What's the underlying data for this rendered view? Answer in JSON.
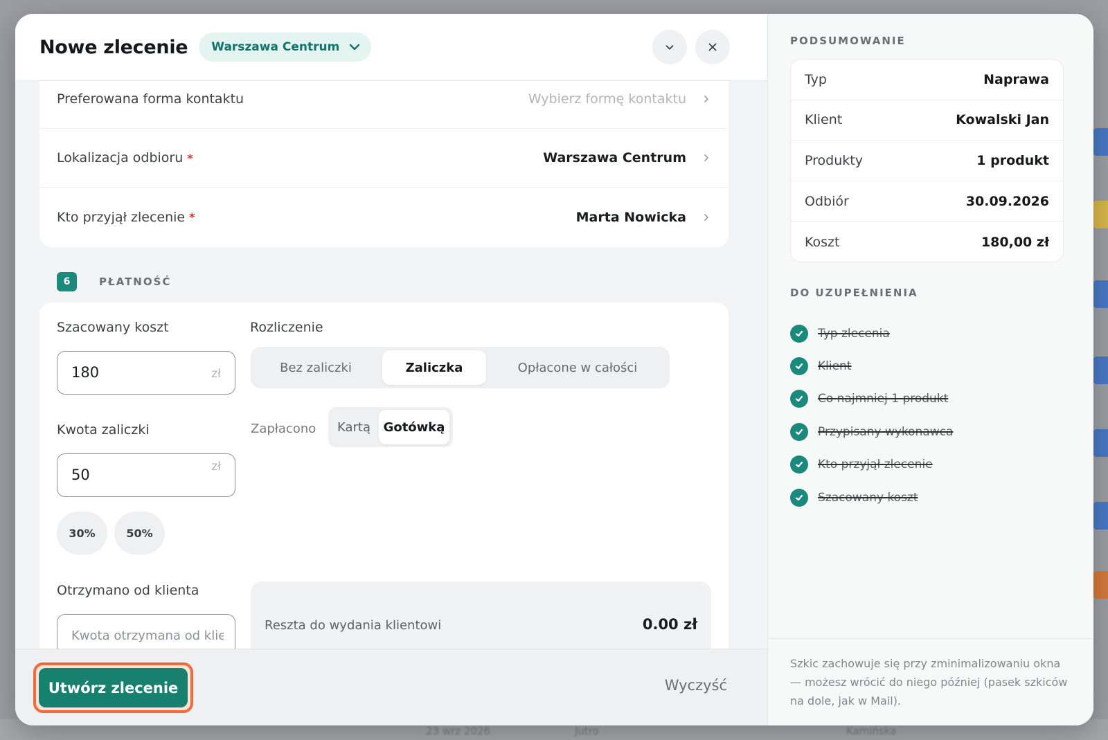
{
  "header": {
    "title": "Nowe zlecenie",
    "location": "Warszawa Centrum"
  },
  "rows": [
    {
      "label": "Preferowana forma kontaktu",
      "required": false,
      "value": "",
      "placeholder": "Wybierz formę kontaktu"
    },
    {
      "label": "Lokalizacja odbioru",
      "required": true,
      "value": "Warszawa Centrum",
      "placeholder": ""
    },
    {
      "label": "Kto przyjął zlecenie",
      "required": true,
      "value": "Marta Nowicka",
      "placeholder": ""
    }
  ],
  "required_mark": "*",
  "payment": {
    "step": "6",
    "title": "PŁATNOŚĆ",
    "estimated_label": "Szacowany koszt",
    "estimated_value": "180",
    "currency": "zł",
    "settlement_label": "Rozliczenie",
    "settlement_options": [
      "Bez zaliczki",
      "Zaliczka",
      "Opłacone w całości"
    ],
    "settlement_selected": "Zaliczka",
    "deposit_label": "Kwota zaliczki",
    "deposit_value": "50",
    "paid_label": "Zapłacono",
    "paid_options": [
      "Kartą",
      "Gotówką"
    ],
    "paid_selected": "Gotówką",
    "percent_buttons": [
      "30%",
      "50%"
    ],
    "received_label": "Otrzymano od klienta",
    "received_placeholder": "Kwota otrzymana od klienta",
    "change_label": "Reszta do wydania klientowi",
    "change_value": "0.00 zł"
  },
  "footer": {
    "create_label": "Utwórz zlecenie",
    "clear_label": "Wyczyść"
  },
  "summary": {
    "heading": "PODSUMOWANIE",
    "rows": [
      {
        "key": "Typ",
        "value": "Naprawa"
      },
      {
        "key": "Klient",
        "value": "Kowalski Jan"
      },
      {
        "key": "Produkty",
        "value": "1 produkt"
      },
      {
        "key": "Odbiór",
        "value": "30.09.2026"
      },
      {
        "key": "Koszt",
        "value": "180,00 zł"
      }
    ]
  },
  "todo": {
    "heading": "DO UZUPEŁNIENIA",
    "items": [
      "Typ zlecenia",
      "Klient",
      "Co najmniej 1 produkt",
      "Przypisany wykonawca",
      "Kto przyjął zlecenie",
      "Szacowany koszt"
    ]
  },
  "note": "Szkic zachowuje się przy zminimalizowaniu okna — możesz wrócić do niego później (pasek szkiców na dole, jak w Mail).",
  "background": {
    "footer_texts": [
      "23 wrz 2026",
      "Jutro",
      "Kamińska"
    ]
  },
  "colors": {
    "accent": "#1b8a7d",
    "primary_button": "#17806f",
    "focus_ring": "#f16a3a",
    "required": "#d8342a"
  },
  "icons": [
    "chevron-down-icon",
    "close-icon",
    "chevron-right-icon",
    "check-icon"
  ]
}
